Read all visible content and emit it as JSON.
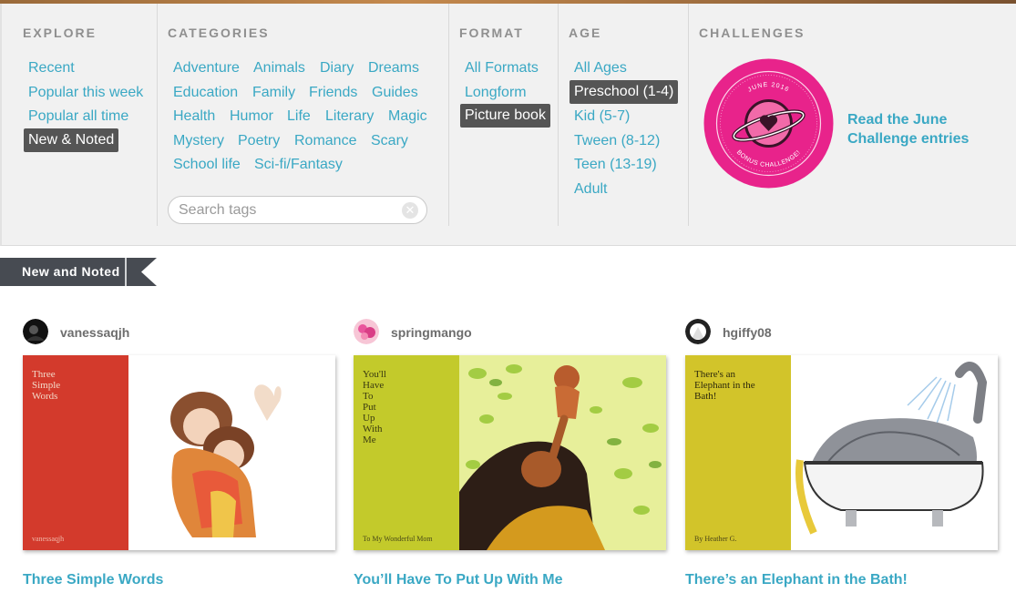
{
  "nav": {
    "explore": {
      "title": "EXPLORE",
      "items": [
        "Recent",
        "Popular this week",
        "Popular all time",
        "New & Noted"
      ]
    },
    "categories": {
      "title": "CATEGORIES",
      "rows": [
        [
          "Adventure",
          "Animals",
          "Diary",
          "Dreams"
        ],
        [
          "Education",
          "Family",
          "Friends",
          "Guides"
        ],
        [
          "Health",
          "Humor",
          "Life",
          "Literary",
          "Magic"
        ],
        [
          "Mystery",
          "Poetry",
          "Romance",
          "Scary"
        ],
        [
          "School life",
          "Sci-fi/Fantasy"
        ]
      ],
      "search_placeholder": "Search tags"
    },
    "format": {
      "title": "FORMAT",
      "items": [
        "All Formats",
        "Longform",
        "Picture book"
      ]
    },
    "age": {
      "title": "AGE",
      "items": [
        "All Ages",
        "Preschool (1-4)",
        "Kid (5-7)",
        "Tween (8-12)",
        "Teen (13-19)",
        "Adult"
      ]
    },
    "challenges": {
      "title": "CHALLENGES",
      "badge_top": "JUNE 2016",
      "badge_bottom": "BONUS CHALLENGE!",
      "link_line1": "Read the June",
      "link_line2": "Challenge entries"
    }
  },
  "section": {
    "label": "New and Noted"
  },
  "books": [
    {
      "author": "vanessaqjh",
      "cover_title_lines": [
        "Three",
        "Simple",
        "Words"
      ],
      "cover_author": "vanessaqjh",
      "title": "Three  Simple  Words"
    },
    {
      "author": "springmango",
      "cover_title_lines": [
        "You'll",
        "Have",
        "To",
        "Put",
        "Up",
        "With",
        "Me"
      ],
      "cover_author": "To My Wonderful Mom",
      "title": "You’ll Have To Put Up With Me"
    },
    {
      "author": "hgiffy08",
      "cover_title_lines": [
        "There's an",
        "Elephant in the",
        "Bath!"
      ],
      "cover_author": "By Heather G.",
      "title": "There’s an Elephant in the Bath!"
    }
  ],
  "colors": {
    "accent": "#3aa8c4",
    "selected_bg": "#555555",
    "badge": "#e8238b",
    "ribbon": "#474b52",
    "cover1_spine": "#d33a2c",
    "cover2_spine": "#c3ca2b",
    "cover3_spine": "#d2c42a"
  },
  "selected": {
    "explore": "New & Noted",
    "format": "Picture book",
    "age": "Preschool (1-4)"
  }
}
